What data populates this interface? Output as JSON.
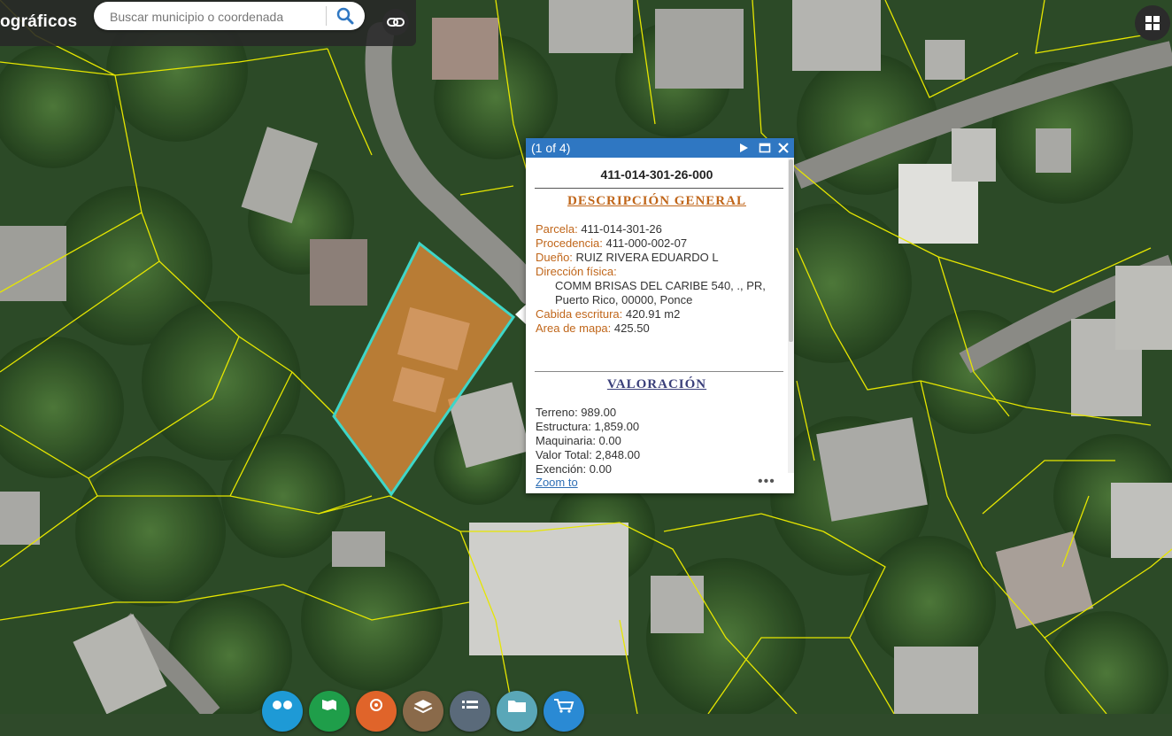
{
  "app": {
    "title": "ográficos"
  },
  "search": {
    "placeholder": "Buscar municipio o coordenada"
  },
  "popup": {
    "count": "(1 of 4)",
    "parcel_id": "411-014-301-26-000",
    "general_title": "DESCRIPCIÓN GENERAL",
    "general_color": "#c0661a",
    "parcela_label": "Parcela:",
    "parcela_value": "411-014-301-26",
    "procedencia_label": "Procedencia:",
    "procedencia_value": "411-000-002-07",
    "dueno_label": "Dueño:",
    "dueno_value": "RUIZ RIVERA EDUARDO L",
    "direccion_label": "Dirección física:",
    "direccion_line1": "COMM BRISAS DEL CARIBE 540, ., PR,",
    "direccion_line2": "Puerto Rico, 00000, Ponce",
    "cabida_label": "Cabida escritura:",
    "cabida_value": "420.91 m2",
    "area_label": "Area de mapa:",
    "area_value": "425.50",
    "valoracion_title": "VALORACIÓN",
    "valoracion_color": "#3a3f7a",
    "terreno": "Terreno: 989.00",
    "estructura": "Estructura: 1,859.00",
    "maquinaria": "Maquinaria: 0.00",
    "valor_total": "Valor Total: 2,848.00",
    "exencion": "Exención: 0.00",
    "zoom_label": "Zoom to",
    "more_label": "•••",
    "header_color": "#2f77c2"
  },
  "toolbar": {
    "tools": [
      {
        "name": "binoculars-icon",
        "color": "#1e9ad6"
      },
      {
        "name": "map-icon",
        "color": "#1f9e4a"
      },
      {
        "name": "analysis-icon",
        "color": "#e0642a"
      },
      {
        "name": "layers-icon",
        "color": "#8a6a4a"
      },
      {
        "name": "list-icon",
        "color": "#5a6a7a"
      },
      {
        "name": "folder-icon",
        "color": "#5aa7b8"
      },
      {
        "name": "cart-icon",
        "color": "#2a8ad4"
      }
    ]
  },
  "colors": {
    "parcel_fill": "#e08a3a",
    "parcel_outline": "#3ed6c8",
    "boundary_lines": "#e6e600"
  }
}
